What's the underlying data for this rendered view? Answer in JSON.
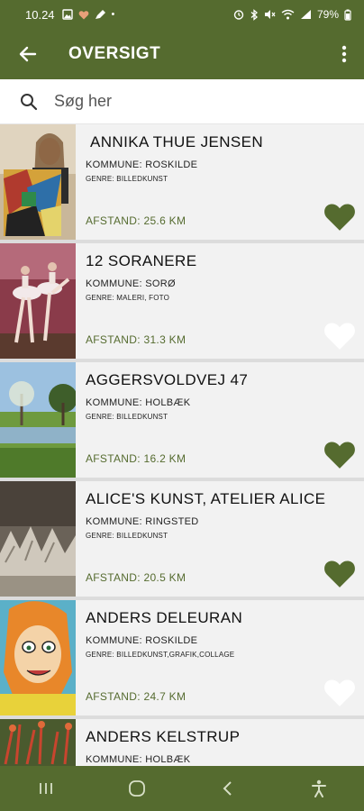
{
  "status_bar": {
    "time": "10.24",
    "battery": "79%"
  },
  "app_bar": {
    "title": "OVERSIGT"
  },
  "search": {
    "placeholder": "Søg her"
  },
  "colors": {
    "brand": "#556b2f",
    "heart_filled": "#556b2f",
    "heart_empty": "#ffffff"
  },
  "items": [
    {
      "name": "ANNIKA THUE JENSEN",
      "kommune": "KOMMUNE: ROSKILDE",
      "genre": "GENRE: BILLEDKUNST",
      "afstand": "AFSTAND: 25.6 KM",
      "favorite": true
    },
    {
      "name": "12 SORANERE",
      "kommune": "KOMMUNE: SORØ",
      "genre": "GENRE: MALERI, FOTO",
      "afstand": "AFSTAND: 31.3 KM",
      "favorite": false
    },
    {
      "name": "AGGERSVOLDVEJ 47",
      "kommune": "KOMMUNE: HOLBÆK",
      "genre": "GENRE: BILLEDKUNST",
      "afstand": "AFSTAND: 16.2 KM",
      "favorite": true
    },
    {
      "name": "ALICE'S KUNST, ATELIER ALICE",
      "kommune": "KOMMUNE: RINGSTED",
      "genre": "GENRE: BILLEDKUNST",
      "afstand": "AFSTAND: 20.5 KM",
      "favorite": true
    },
    {
      "name": "ANDERS DELEURAN",
      "kommune": "KOMMUNE: ROSKILDE",
      "genre": "GENRE: BILLEDKUNST,GRAFIK,COLLAGE",
      "afstand": "AFSTAND: 24.7 KM",
      "favorite": false
    },
    {
      "name": "ANDERS KELSTRUP",
      "kommune": "KOMMUNE: HOLBÆK"
    }
  ]
}
